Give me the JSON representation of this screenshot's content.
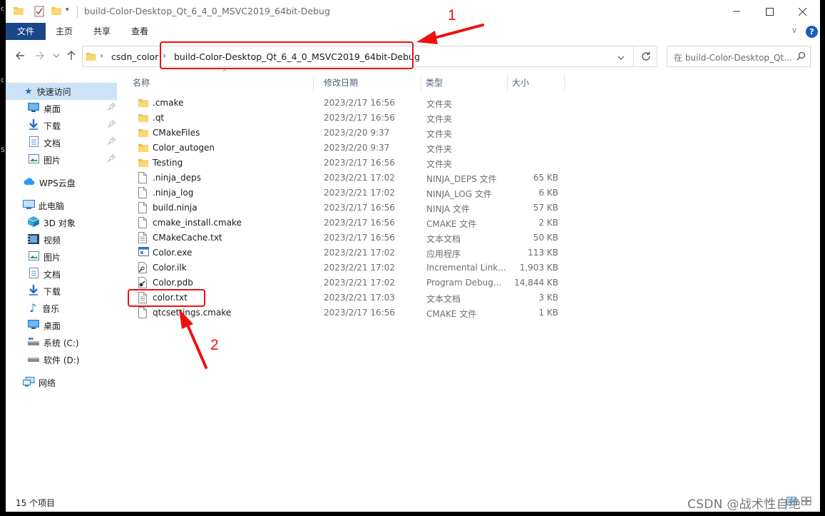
{
  "window": {
    "title": "build-Color-Desktop_Qt_6_4_0_MSVC2019_64bit-Debug"
  },
  "ribbon": {
    "tabs": [
      "文件",
      "主页",
      "共享",
      "查看"
    ],
    "help": "?"
  },
  "address": {
    "crumbs": [
      "csdn_color",
      "build-Color-Desktop_Qt_6_4_0_MSVC2019_64bit-Debug"
    ]
  },
  "search": {
    "placeholder": "在 build-Color-Desktop_Qt..."
  },
  "sidebar": {
    "quick_access": "快速访问",
    "quick_items": [
      {
        "label": "桌面",
        "icon": "desktop-icon",
        "pinned": true
      },
      {
        "label": "下载",
        "icon": "download-icon",
        "pinned": true
      },
      {
        "label": "文档",
        "icon": "document-icon",
        "pinned": true
      },
      {
        "label": "图片",
        "icon": "picture-icon",
        "pinned": true
      }
    ],
    "wps": "WPS云盘",
    "this_pc": "此电脑",
    "pc_items": [
      {
        "label": "3D 对象",
        "icon": "3d-objects-icon"
      },
      {
        "label": "视频",
        "icon": "video-icon"
      },
      {
        "label": "图片",
        "icon": "picture-icon"
      },
      {
        "label": "文档",
        "icon": "document-icon"
      },
      {
        "label": "下载",
        "icon": "download-icon"
      },
      {
        "label": "音乐",
        "icon": "music-icon"
      },
      {
        "label": "桌面",
        "icon": "desktop-icon"
      },
      {
        "label": "系统 (C:)",
        "icon": "system-drive-icon"
      },
      {
        "label": "软件 (D:)",
        "icon": "drive-icon"
      }
    ],
    "network": "网络"
  },
  "columns": {
    "name": "名称",
    "date": "修改日期",
    "type": "类型",
    "size": "大小"
  },
  "files": [
    {
      "name": ".cmake",
      "date": "2023/2/17 16:56",
      "type": "文件夹",
      "size": "",
      "icon": "folder-icon"
    },
    {
      "name": ".qt",
      "date": "2023/2/17 16:56",
      "type": "文件夹",
      "size": "",
      "icon": "folder-icon"
    },
    {
      "name": "CMakeFiles",
      "date": "2023/2/20 9:37",
      "type": "文件夹",
      "size": "",
      "icon": "folder-icon"
    },
    {
      "name": "Color_autogen",
      "date": "2023/2/20 9:37",
      "type": "文件夹",
      "size": "",
      "icon": "folder-icon"
    },
    {
      "name": "Testing",
      "date": "2023/2/17 16:56",
      "type": "文件夹",
      "size": "",
      "icon": "folder-icon"
    },
    {
      "name": ".ninja_deps",
      "date": "2023/2/21 17:02",
      "type": "NINJA_DEPS 文件",
      "size": "65 KB",
      "icon": "file-icon"
    },
    {
      "name": ".ninja_log",
      "date": "2023/2/21 17:02",
      "type": "NINJA_LOG 文件",
      "size": "6 KB",
      "icon": "file-icon"
    },
    {
      "name": "build.ninja",
      "date": "2023/2/17 16:56",
      "type": "NINJA 文件",
      "size": "57 KB",
      "icon": "file-icon"
    },
    {
      "name": "cmake_install.cmake",
      "date": "2023/2/17 16:56",
      "type": "CMAKE 文件",
      "size": "2 KB",
      "icon": "file-icon"
    },
    {
      "name": "CMakeCache.txt",
      "date": "2023/2/17 16:56",
      "type": "文本文档",
      "size": "50 KB",
      "icon": "text-file-icon"
    },
    {
      "name": "Color.exe",
      "date": "2023/2/21 17:02",
      "type": "应用程序",
      "size": "113 KB",
      "icon": "exe-icon"
    },
    {
      "name": "Color.ilk",
      "date": "2023/2/21 17:02",
      "type": "Incremental Link...",
      "size": "1,903 KB",
      "icon": "ilk-icon"
    },
    {
      "name": "Color.pdb",
      "date": "2023/2/21 17:02",
      "type": "Program Debug...",
      "size": "14,844 KB",
      "icon": "pdb-icon"
    },
    {
      "name": "color.txt",
      "date": "2023/2/21 17:03",
      "type": "文本文档",
      "size": "3 KB",
      "icon": "text-file-icon"
    },
    {
      "name": "qtcsettings.cmake",
      "date": "2023/2/17 16:56",
      "type": "CMAKE 文件",
      "size": "1 KB",
      "icon": "file-icon"
    }
  ],
  "status": {
    "item_count": "15 个项目"
  },
  "annotations": {
    "label_1": "1",
    "label_2": "2",
    "color": "#ee1111"
  },
  "watermark": "CSDN @战术性自绝"
}
